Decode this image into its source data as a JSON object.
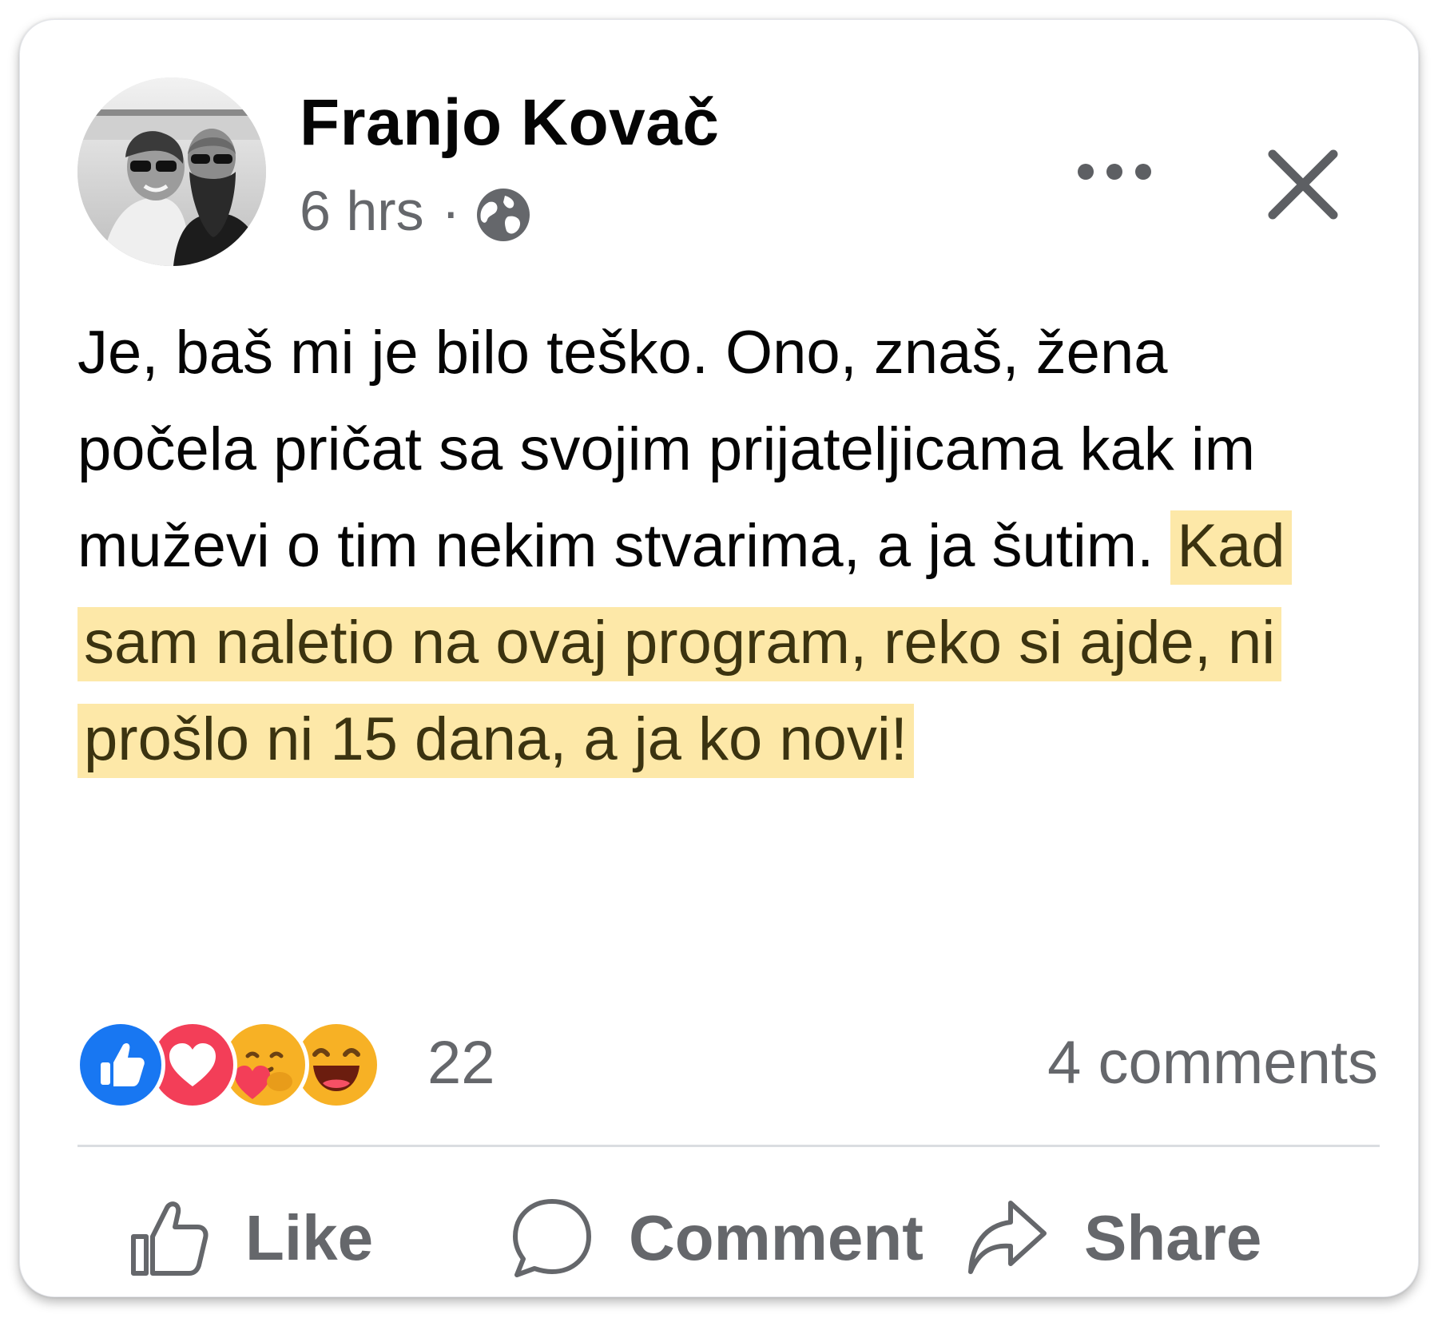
{
  "post": {
    "author": "Franjo Kovač",
    "time": "6 hrs",
    "separator": "·",
    "audience_icon": "globe-icon",
    "body": [
      {
        "text": "Je, baš mi je bilo teško. Ono, znaš, žena počela pričat sa svojim prijateljicama kak im muževi o tim nekim stvarima, a ja šutim.",
        "highlighted": false
      },
      {
        "text": "Kad sam naletio na ovaj program, reko si ajde, ni prošlo ni 15 dana, a ja ko novi!",
        "highlighted": true
      }
    ],
    "highlight_color": "#fde8a8"
  },
  "header_actions": {
    "more_icon": "more-horizontal-icon",
    "close_icon": "close-icon"
  },
  "reactions": {
    "icons": [
      "like-reaction-icon",
      "love-reaction-icon",
      "care-reaction-icon",
      "haha-reaction-icon"
    ],
    "count": "22",
    "comments": "4 comments"
  },
  "actions": {
    "like": "Like",
    "comment": "Comment",
    "share": "Share"
  },
  "colors": {
    "text_primary": "#050505",
    "text_secondary": "#65676b",
    "like_blue": "#1877f2",
    "love_red": "#f33e58",
    "emoji_yellow": "#f7b125"
  }
}
